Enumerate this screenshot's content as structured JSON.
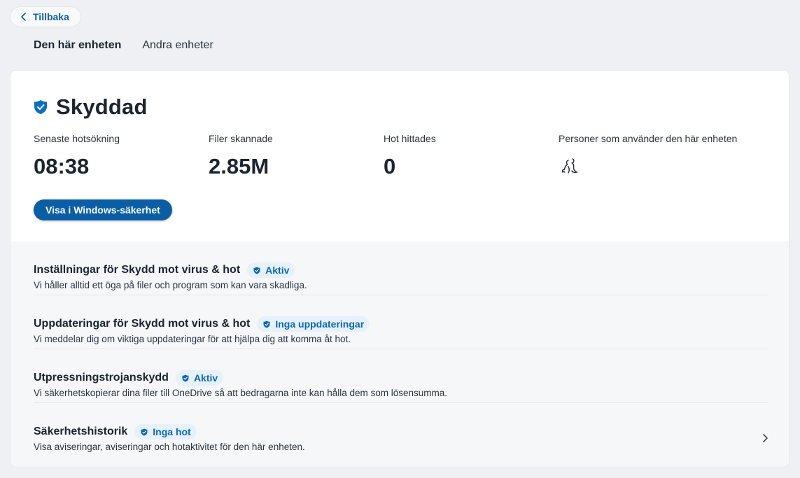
{
  "back": {
    "label": "Tillbaka",
    "icon": "chevron-left-icon"
  },
  "tabs": [
    {
      "label": "Den här enheten",
      "active": true
    },
    {
      "label": "Andra enheter",
      "active": false
    }
  ],
  "status": {
    "title": "Skyddad",
    "icon": "shield-check-icon",
    "color": "#0a6fc2"
  },
  "stats": [
    {
      "label": "Senaste hotsökning",
      "value": "08:38"
    },
    {
      "label": "Filer skannade",
      "value": "2.85M"
    },
    {
      "label": "Hot hittades",
      "value": "0"
    },
    {
      "label": "Personer som använder den här enheten",
      "icon": "people-icon"
    }
  ],
  "primary_button": {
    "label": "Visa i Windows-säkerhet",
    "color": "#0a5ea6"
  },
  "features": [
    {
      "title": "Inställningar för Skydd mot virus & hot",
      "badge": "Aktiv",
      "description": "Vi håller alltid ett öga på filer och program som kan vara skadliga."
    },
    {
      "title": "Uppdateringar för Skydd mot virus & hot",
      "badge": "Inga uppdateringar",
      "description": "Vi meddelar dig om viktiga uppdateringar för att hjälpa dig att komma åt hot."
    },
    {
      "title": "Utpressningstrojanskydd",
      "badge": "Aktiv",
      "description": "Vi säkerhetskopierar dina filer till OneDrive så att bedragarna inte kan hålla dem som lösensumma."
    },
    {
      "title": "Säkerhetshistorik",
      "badge": "Inga hot",
      "description": "Visa aviseringar, aviseringar och hotaktivitet för den här enheten.",
      "icon": "chevron-right-icon"
    }
  ]
}
